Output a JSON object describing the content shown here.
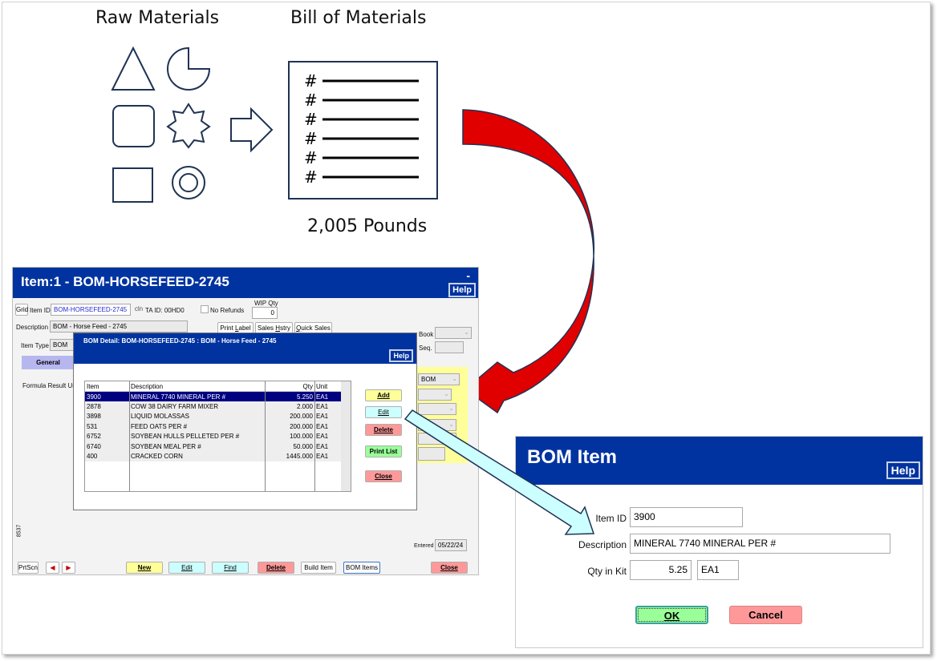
{
  "diagram": {
    "raw_materials_title": "Raw Materials",
    "bom_title": "Bill of Materials",
    "bom_line_marker": "#",
    "bom_line_count": 6,
    "total_weight": "2,005 Pounds",
    "colors": {
      "outline": "#1f3354",
      "red_arrow": "#e00000",
      "cyan_arrow": "#ccffff"
    }
  },
  "item_window": {
    "title": "Item:1 - BOM-HORSEFEED-2745",
    "minimize_label": "-",
    "help_label": "Help",
    "grid_button": "Grid",
    "item_id_label": "Item ID",
    "item_id_value": "BOM-HORSEFEED-2745",
    "cln_label": "cln",
    "ta_id": "TA ID: 00HD0",
    "no_refunds_label": "No Refunds",
    "wip_qty_label": "WIP Qty",
    "wip_qty_value": "0",
    "description_label": "Description",
    "description_value": "BOM - Horse Feed - 2745",
    "print_label_button": "Print Label",
    "sales_history_button": "Sales Hstry",
    "quick_sales_button": "Quick Sales",
    "book_label": "Book",
    "seq_label": "Seq.",
    "item_type_label": "Item Type",
    "item_type_value": "BOM",
    "general_tab": "General",
    "formula_result_label": "Formula Result Un",
    "side_select_value": "BOM",
    "record_number": "8537",
    "entered_label": "Entered",
    "entered_value": "05/22/24",
    "footer": {
      "prtscn": "PrtScn",
      "new": "New",
      "edit": "Edit",
      "find": "Find",
      "delete": "Delete",
      "build_item": "Build Item",
      "bom_items": "BOM Items",
      "close": "Close"
    }
  },
  "bom_detail": {
    "title": "BOM Detail: BOM-HORSEFEED-2745 : BOM - Horse Feed - 2745",
    "help_label": "Help",
    "columns": [
      "Item",
      "Description",
      "Qty",
      "Unit"
    ],
    "rows": [
      {
        "item": "3900",
        "description": "MINERAL 7740 MINERAL PER #",
        "qty": "5.250",
        "unit": "EA1",
        "selected": true
      },
      {
        "item": "2878",
        "description": "COW 38 DAIRY FARM MIXER",
        "qty": "2.000",
        "unit": "EA1"
      },
      {
        "item": "3898",
        "description": "LIQUID MOLASSAS",
        "qty": "200.000",
        "unit": "EA1"
      },
      {
        "item": "531",
        "description": "FEED OATS PER #",
        "qty": "200.000",
        "unit": "EA1"
      },
      {
        "item": "6752",
        "description": "SOYBEAN HULLS PELLETED PER #",
        "qty": "100.000",
        "unit": "EA1"
      },
      {
        "item": "6740",
        "description": "SOYBEAN MEAL PER #",
        "qty": "50.000",
        "unit": "EA1"
      },
      {
        "item": "400",
        "description": "CRACKED CORN",
        "qty": "1445.000",
        "unit": "EA1"
      }
    ],
    "buttons": {
      "add": "Add",
      "edit": "Edit",
      "delete": "Delete",
      "print_list": "Print List",
      "close": "Close"
    }
  },
  "bom_item_dialog": {
    "title": "BOM Item",
    "help_label": "Help",
    "item_id_label": "Item ID",
    "item_id_value": "3900",
    "description_label": "Description",
    "description_value": "MINERAL 7740 MINERAL PER #",
    "qty_label": "Qty in Kit",
    "qty_value": "5.25",
    "unit_value": "EA1",
    "ok_label": "OK",
    "cancel_label": "Cancel"
  }
}
